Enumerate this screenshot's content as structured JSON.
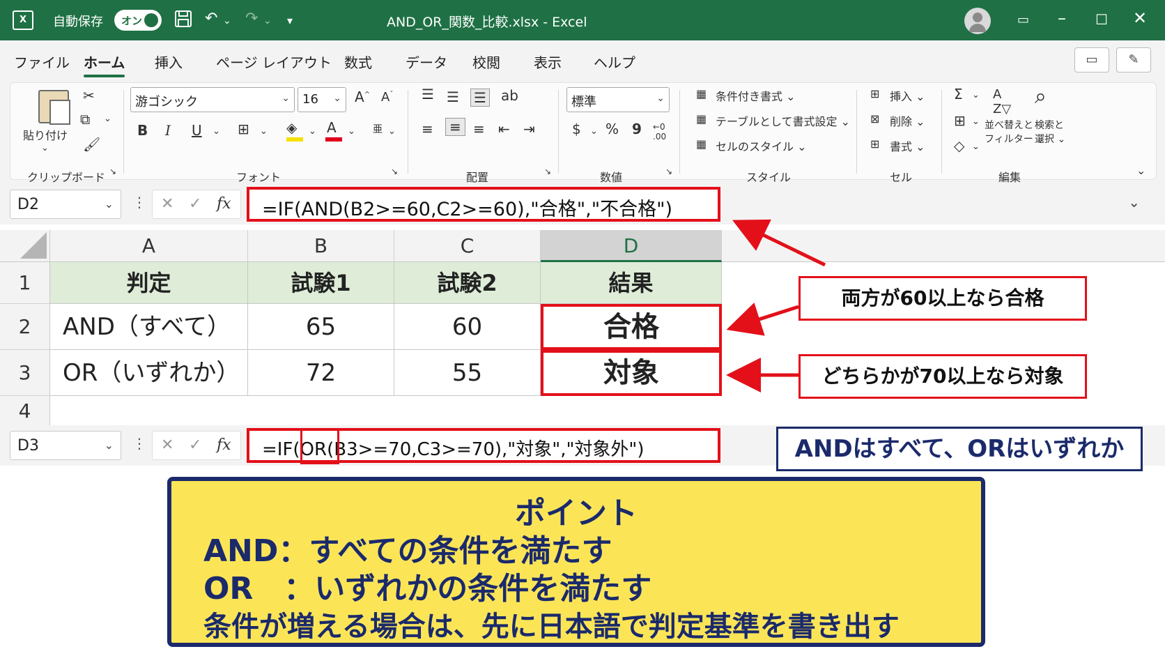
{
  "titlebar": {
    "logo": "X",
    "autosave_label": "自動保存",
    "autosave_state": "オン",
    "document_title": "AND_OR_関数_比較.xlsx  -  Excel"
  },
  "menu": {
    "tabs": [
      "ファイル",
      "ホーム",
      "挿入",
      "ページ レイアウト",
      "数式",
      "データ",
      "校閲",
      "表示",
      "ヘルプ"
    ],
    "active": "ホーム"
  },
  "ribbon": {
    "clipboard": {
      "paste_label": "貼り付け",
      "group_label": "クリップボード"
    },
    "font": {
      "font_name": "游ゴシック",
      "font_size": "16",
      "group_label": "フォント",
      "bold": "B",
      "italic": "I",
      "underline": "U"
    },
    "alignment": {
      "group_label": "配置"
    },
    "number": {
      "format": "標準",
      "group_label": "数値",
      "currency": "$",
      "percent": "%",
      "comma": "9"
    },
    "styles": {
      "items": [
        "条件付き書式 ⌄",
        "テーブルとして書式設定 ⌄",
        "セルのスタイル ⌄"
      ],
      "group_label": "スタイル"
    },
    "cells": {
      "items": [
        "挿入 ⌄",
        "削除 ⌄",
        "書式 ⌄"
      ],
      "group_label": "セル"
    },
    "editing": {
      "sort_label": "並べ替えと",
      "filter_label": "フィルター ⌄",
      "find_label": "検索と",
      "select_label": "選択 ⌄",
      "group_label": "編集"
    }
  },
  "formula_bar_1": {
    "cell_ref": "D2",
    "formula": "=IF(AND(B2>=60,C2>=60),\"合格\",\"不合格\")"
  },
  "formula_bar_2": {
    "cell_ref": "D3",
    "formula": "=IF(OR(B3>=70,C3>=70),\"対象\",\"対象外\")"
  },
  "sheet": {
    "columns": [
      "A",
      "B",
      "C",
      "D"
    ],
    "rows": [
      "1",
      "2",
      "3",
      "4"
    ],
    "header": [
      "判定",
      "試験1",
      "試験2",
      "結果"
    ],
    "data": [
      [
        "AND（すべて）",
        "65",
        "60",
        "合格"
      ],
      [
        "OR（いずれか）",
        "72",
        "55",
        "対象"
      ]
    ]
  },
  "callouts": {
    "and_note": "両方が60以上なら合格",
    "or_note": "どちらかが70以上なら対象",
    "summary_note": "ANDはすべて、ORはいずれか"
  },
  "point": {
    "title": "ポイント",
    "line1": "AND：すべての条件を満たす",
    "line2": "OR　：いずれかの条件を満たす",
    "line3": "条件が増える場合は、先に日本語で判定基準を書き出す"
  },
  "colors": {
    "excel_green": "#1f7145",
    "highlight_red": "#e3101a",
    "navy": "#1b2a6b",
    "point_yellow": "#fbe557",
    "header_green": "#deecd8"
  }
}
